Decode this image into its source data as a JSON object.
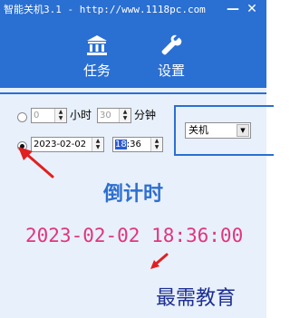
{
  "window": {
    "title": "智能关机3.1 - http://www.1118pc.com",
    "minimize_label": "—",
    "close_label": "✕"
  },
  "nav": {
    "items": [
      {
        "label": "任务",
        "icon": "bank-icon"
      },
      {
        "label": "设置",
        "icon": "wrench-icon"
      }
    ]
  },
  "timer": {
    "hours_value": "0",
    "hours_label": "小时",
    "minutes_value": "30",
    "minutes_label": "分钟",
    "date_value": "2023-02-02",
    "time_hour": "18",
    "time_rest": ":36",
    "mode_selected": "datetime"
  },
  "action": {
    "selected": "关机"
  },
  "countdown": {
    "label": "倒计时",
    "value": "2023-02-02 18:36:00"
  },
  "watermark": "最需教育",
  "colors": {
    "accent": "#2a6fd2",
    "countdown_label": "#2d6fcf",
    "countdown_value": "#e0357f",
    "annotation_arrow": "#e02020"
  }
}
